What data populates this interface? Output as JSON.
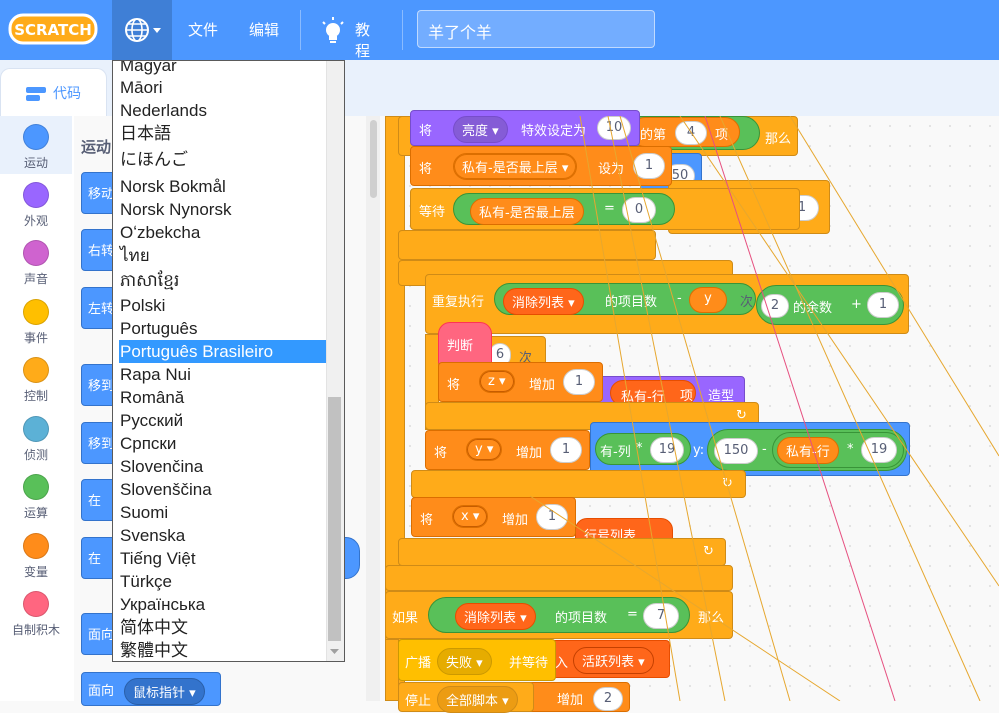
{
  "menubar": {
    "logo_text": "SCRATCH",
    "file_label": "文件",
    "edit_label": "编辑",
    "tutorial_label": "教程",
    "project_title": "羊了个羊"
  },
  "tabs": {
    "code_label": "代码"
  },
  "categories": [
    {
      "label": "运动",
      "color": "#4c97ff"
    },
    {
      "label": "外观",
      "color": "#9966ff"
    },
    {
      "label": "声音",
      "color": "#cf63cf"
    },
    {
      "label": "事件",
      "color": "#ffbf00"
    },
    {
      "label": "控制",
      "color": "#ffab19"
    },
    {
      "label": "侦测",
      "color": "#5cb1d6"
    },
    {
      "label": "运算",
      "color": "#59c059"
    },
    {
      "label": "变量",
      "color": "#ff8c1a"
    },
    {
      "label": "自制积木",
      "color": "#ff6680"
    }
  ],
  "palette": {
    "title": "运动",
    "blocks": [
      "移动",
      "右转",
      "左转",
      "移到",
      "移到",
      "在",
      "在",
      "面向",
      "面向"
    ],
    "last_block_dropdown": "鼠标指针"
  },
  "language_menu": {
    "items": [
      "Magyar",
      "Māori",
      "Nederlands",
      "日本語",
      "にほんご",
      "Norsk Bokmål",
      "Norsk Nynorsk",
      "Oʻzbekcha",
      "ไทย",
      "ភាសាខ្មែរ",
      "Polski",
      "Português",
      "Português Brasileiro",
      "Rapa Nui",
      "Română",
      "Русский",
      "Српски",
      "Slovenčina",
      "Slovenščina",
      "Suomi",
      "Svenska",
      "Tiếng Việt",
      "Türkçe",
      "Українська",
      "简体中文",
      "繁體中文"
    ],
    "selected": "Português Brasileiro"
  },
  "workspace": {
    "b1": {
      "verb": "将",
      "effect": "亮度",
      "text": "特效设定为",
      "value": "10",
      "of": "的第",
      "idx": "4",
      "item": "项",
      "then": "那么"
    },
    "b2": {
      "verb": "将",
      "var": "私有-是否最上层",
      "text": "设为",
      "value": "1",
      "extra": "50"
    },
    "b3": {
      "verb": "等待",
      "var": "私有-是否最上层",
      "eq": "=",
      "value": "0",
      "right": "1"
    },
    "b4": {
      "verb": "重复执行",
      "list": "消除列表",
      "text": "的项目数",
      "minus": "-",
      "y": "y",
      "times": "次",
      "n": "2",
      "mod": "的余数",
      "plus": "+",
      "one": "1"
    },
    "b5": {
      "label": "判断",
      "n": "6",
      "times": "次"
    },
    "b6": {
      "verb": "将",
      "var": "z",
      "text": "增加",
      "value": "1",
      "behind1": "私有-行",
      "behind2": "项",
      "behind3": "造型"
    },
    "b7": {
      "verb": "将",
      "var": "y",
      "text": "增加",
      "value": "1",
      "col": "有-列",
      "mul": "*",
      "n19": "19",
      "ylabel": "y:",
      "y150": "150",
      "minus": "-",
      "row": "私有-行",
      "mul2": "*",
      "n19b": "19"
    },
    "b8": {
      "verb": "将",
      "var": "x",
      "text": "增加",
      "value": "1",
      "behind": "行号列表"
    },
    "b9": {
      "verb": "如果",
      "list": "消除列表",
      "text": "的项目数",
      "eq": "=",
      "value": "7",
      "then": "那么"
    },
    "b10": {
      "verb": "广播",
      "msg": "失败",
      "wait": "并等待",
      "in": "入",
      "list": "活跃列表"
    },
    "b11": {
      "verb": "停止",
      "opt": "全部脚本",
      "text": "增加",
      "value": "2"
    }
  }
}
